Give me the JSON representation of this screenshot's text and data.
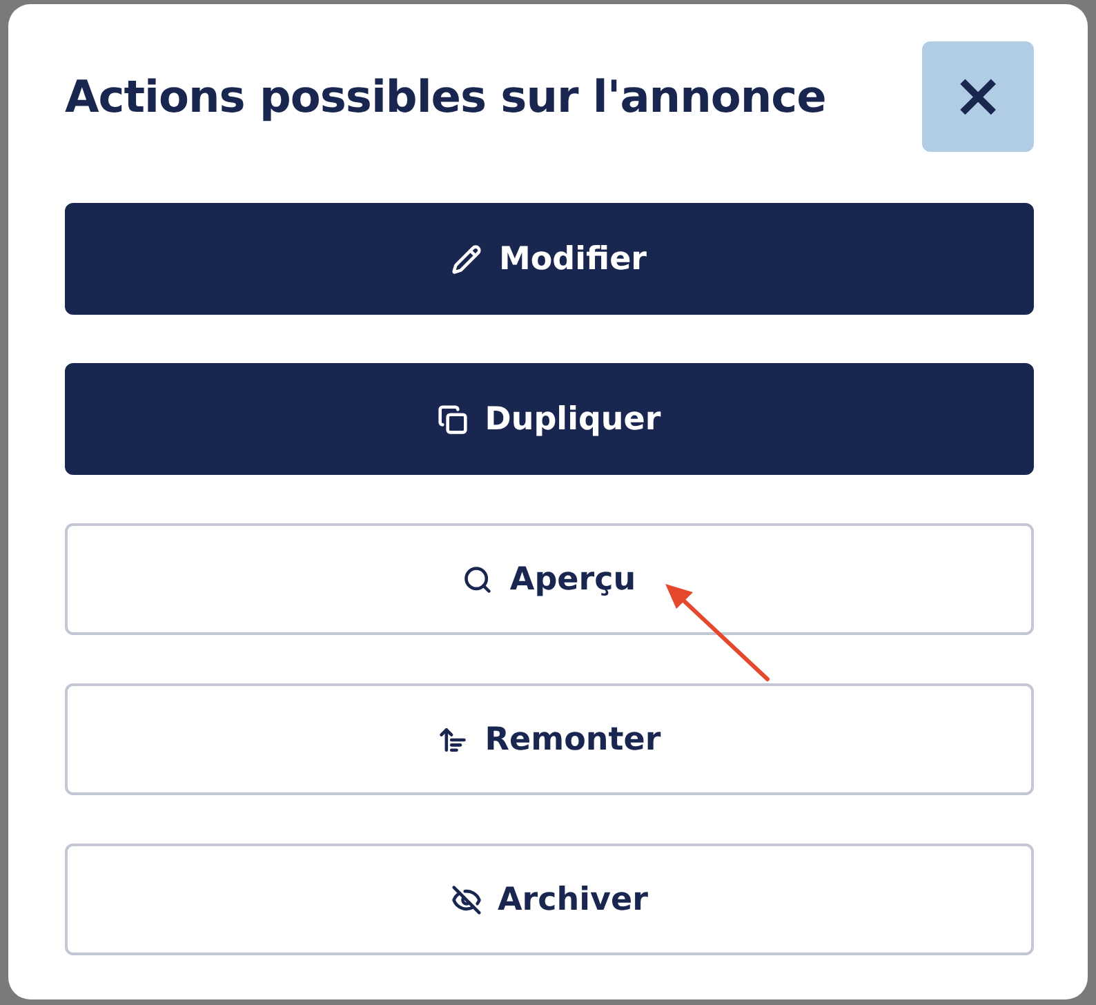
{
  "dialog": {
    "title": "Actions possibles sur l'annonce",
    "close": "×"
  },
  "actions": [
    {
      "label": "Modifier",
      "kind": "primary"
    },
    {
      "label": "Dupliquer",
      "kind": "primary"
    },
    {
      "label": "Aperçu",
      "kind": "outline"
    },
    {
      "label": "Remonter",
      "kind": "outline"
    },
    {
      "label": "Archiver",
      "kind": "outline"
    }
  ]
}
